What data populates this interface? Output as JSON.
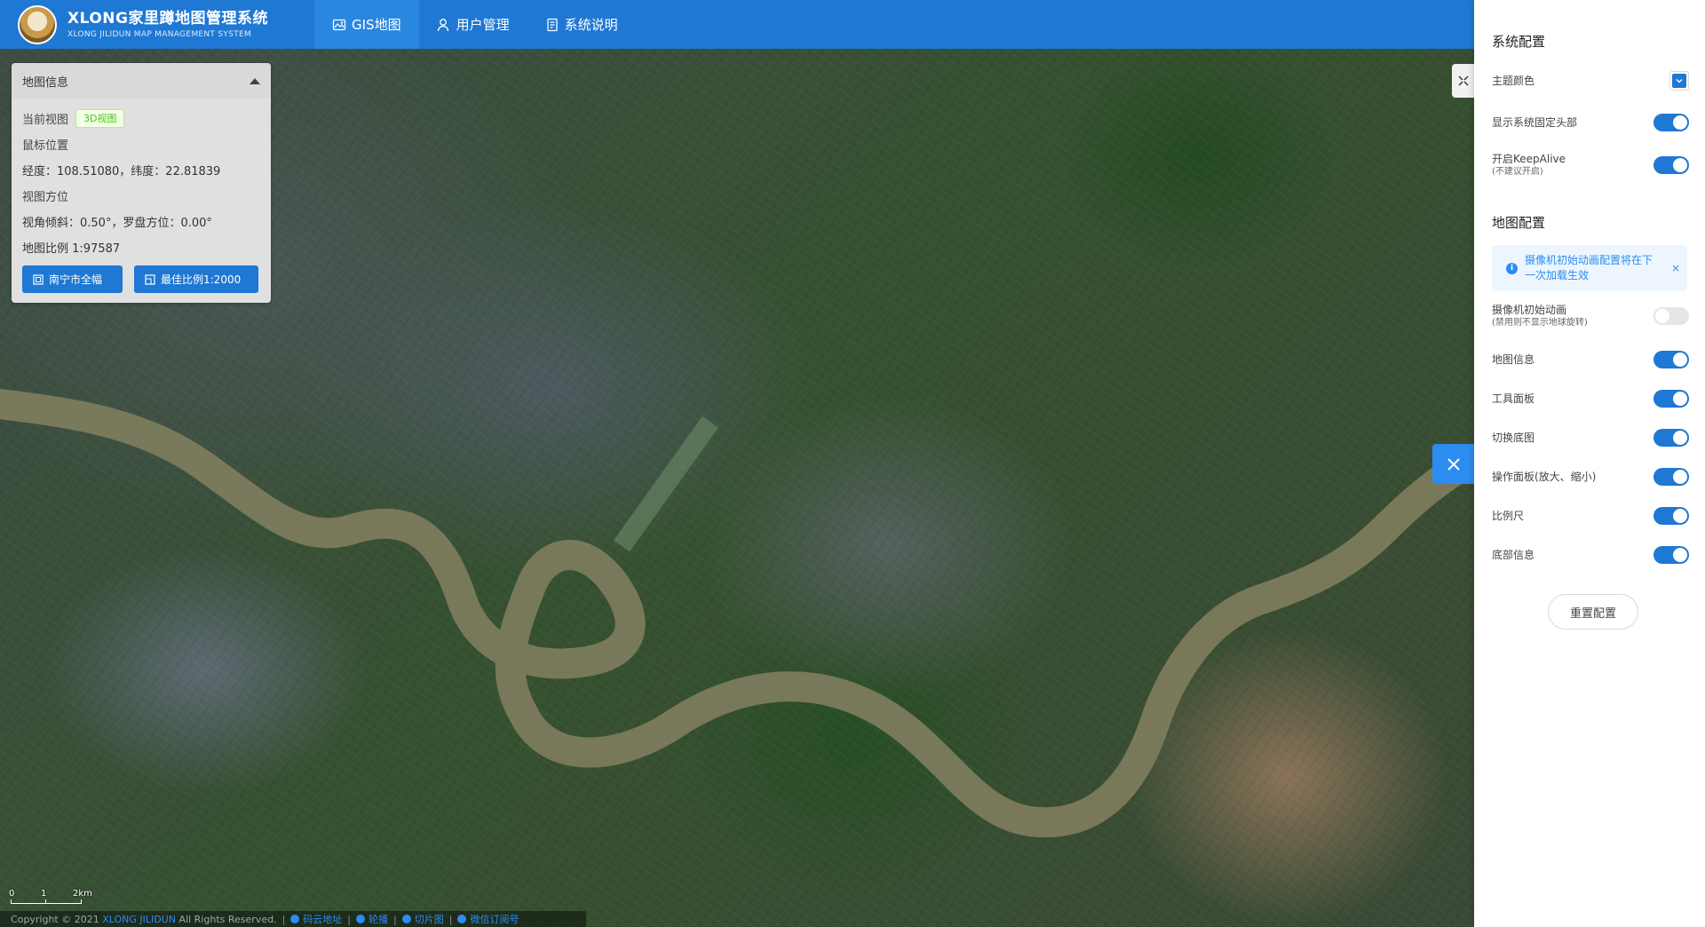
{
  "header": {
    "title": "XLONG家里蹲地图管理系统",
    "subtitle": "XLONG JILIDUN MAP MANAGEMENT SYSTEM",
    "nav": [
      {
        "label": "GIS地图",
        "icon": "map-icon"
      },
      {
        "label": "用户管理",
        "icon": "user-icon"
      },
      {
        "label": "系统说明",
        "icon": "document-icon"
      }
    ]
  },
  "info_panel": {
    "title": "地图信息",
    "view_label": "当前视图",
    "view_tag": "3D视图",
    "mouse_label": "鼠标位置",
    "coords": "经度：108.51080，纬度：22.81839",
    "orientation_label": "视图方位",
    "orientation": "视角倾斜：0.50°，罗盘方位：0.00°",
    "scale": "地图比例 1:97587",
    "btn_full": "南宁市全幅",
    "btn_best": "最佳比例1:2000"
  },
  "scale_bar": {
    "t0": "0",
    "t1": "1",
    "t2": "2km"
  },
  "footer": {
    "copyright": "Copyright © 2021",
    "owner": "XLONG JILIDUN",
    "rights": "All Rights Reserved.",
    "link1": "码云地址",
    "link2": "轮播",
    "link3": "切片图",
    "link4": "微信订阅号"
  },
  "drawer": {
    "system_title": "系统配置",
    "theme_color_label": "主题颜色",
    "theme_color": "#1e78d4",
    "fixed_header_label": "显示系统固定头部",
    "keepalive_label": "开启KeepAlive",
    "keepalive_sub": "(不建议开启)",
    "map_title": "地图配置",
    "alert_text": "摄像机初始动画配置将在下一次加载生效",
    "camera_label": "摄像机初始动画",
    "camera_sub": "(禁用则不显示地球旋转)",
    "map_info_label": "地图信息",
    "tool_panel_label": "工具面板",
    "switch_base_label": "切换底图",
    "op_panel_label": "操作面板(放大、缩小)",
    "scale_label": "比例尺",
    "bottom_info_label": "底部信息",
    "reset_label": "重置配置"
  }
}
